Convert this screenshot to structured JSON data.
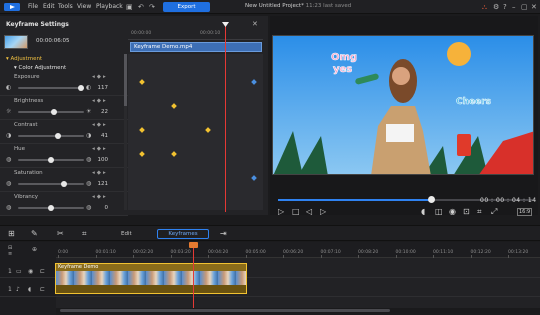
{
  "app": {
    "menu": [
      "File",
      "Edit",
      "Tools",
      "View",
      "Playback"
    ],
    "export_label": "Export",
    "project_title": "New Untitled Project*",
    "project_status": "11:23 last saved",
    "accent": "#1f6fe0"
  },
  "keyframe_panel": {
    "title": "Keyframe Settings",
    "current_time": "00:00:06:05",
    "ruler_times": [
      "00:00:00",
      "00:00:10"
    ],
    "clip_name": "Keyframe Demo.mp4",
    "section_adjustment": "Adjustment",
    "section_color": "Color Adjustment",
    "properties": [
      {
        "label": "Exposure",
        "value": "117",
        "level": 0.95
      },
      {
        "label": "Brightness",
        "value": "22",
        "level": 0.55
      },
      {
        "label": "Contrast",
        "value": "41",
        "level": 0.6
      },
      {
        "label": "Hue",
        "value": "100",
        "level": 0.5
      },
      {
        "label": "Saturation",
        "value": "121",
        "level": 0.7
      },
      {
        "label": "Vibrancy",
        "value": "0",
        "level": 0.5
      }
    ]
  },
  "preview": {
    "time": "00 : 00 : 04 : 14",
    "progress": 0.6,
    "ratio": "16:9",
    "stickers": [
      "Omg yes",
      "Cheers",
      "Soda"
    ]
  },
  "timeline": {
    "edit_label": "Edit",
    "keyframes_label": "Keyframes",
    "ruler": [
      "0:00",
      "00:01:10",
      "00:02:20",
      "00:03:20",
      "00:04:20",
      "00:05:00",
      "00:06:20",
      "00:07:10",
      "00:08:20",
      "00:10:00",
      "00:11:10",
      "00:12:20",
      "00:13:20"
    ],
    "track_labels": [
      "1",
      "1"
    ],
    "clip_name": "Keyframe Demo"
  }
}
